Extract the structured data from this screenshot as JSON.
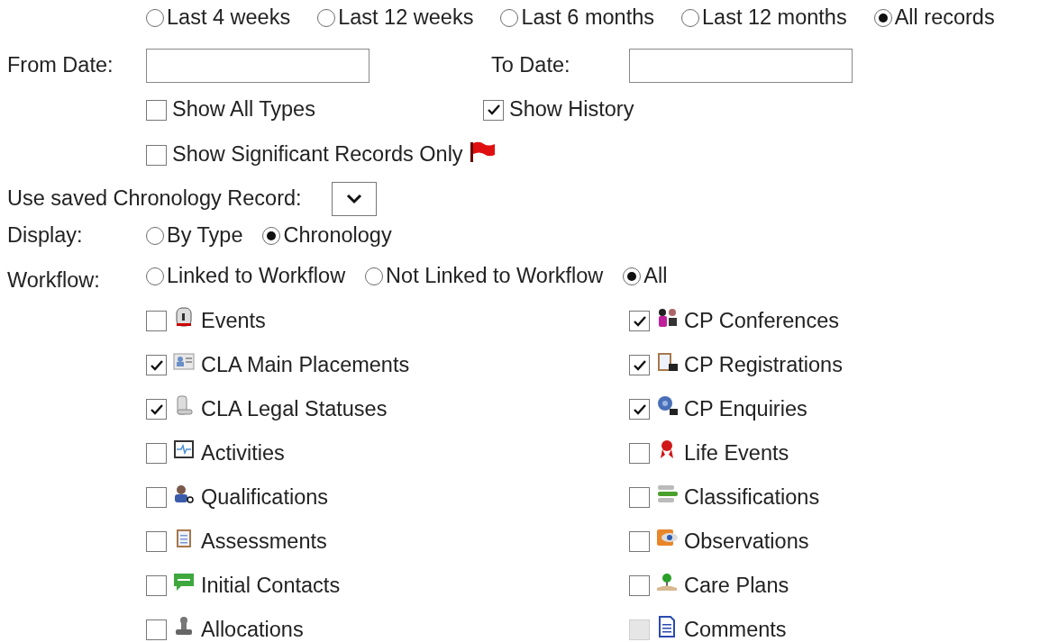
{
  "period_options": [
    {
      "label": "Last 4 weeks",
      "selected": false
    },
    {
      "label": "Last 12 weeks",
      "selected": false
    },
    {
      "label": "Last 6 months",
      "selected": false
    },
    {
      "label": "Last 12 months",
      "selected": false
    },
    {
      "label": "All records",
      "selected": true
    }
  ],
  "from_date": {
    "label": "From Date:"
  },
  "to_date": {
    "label": "To Date:"
  },
  "show_all_types": {
    "label": "Show All Types",
    "checked": false
  },
  "show_history": {
    "label": "Show History",
    "checked": true
  },
  "show_significant": {
    "label": "Show Significant Records Only",
    "checked": false
  },
  "saved_record": {
    "label": "Use saved Chronology Record:"
  },
  "display": {
    "label": "Display:",
    "options": [
      {
        "label": "By Type",
        "selected": false
      },
      {
        "label": "Chronology",
        "selected": true
      }
    ]
  },
  "workflow": {
    "label": "Workflow:",
    "options": [
      {
        "label": "Linked to Workflow",
        "selected": false
      },
      {
        "label": "Not Linked to Workflow",
        "selected": false
      },
      {
        "label": "All",
        "selected": true
      }
    ]
  },
  "record_types": [
    {
      "left": {
        "label": "Events",
        "checked": false,
        "disabled": false
      },
      "right": {
        "label": "CP Conferences",
        "checked": true,
        "disabled": false
      }
    },
    {
      "left": {
        "label": "CLA Main Placements",
        "checked": true,
        "disabled": false
      },
      "right": {
        "label": "CP Registrations",
        "checked": true,
        "disabled": false
      }
    },
    {
      "left": {
        "label": "CLA Legal Statuses",
        "checked": true,
        "disabled": false
      },
      "right": {
        "label": "CP Enquiries",
        "checked": true,
        "disabled": false
      }
    },
    {
      "left": {
        "label": "Activities",
        "checked": false,
        "disabled": false
      },
      "right": {
        "label": "Life Events",
        "checked": false,
        "disabled": false
      }
    },
    {
      "left": {
        "label": "Qualifications",
        "checked": false,
        "disabled": false
      },
      "right": {
        "label": "Classifications",
        "checked": false,
        "disabled": false
      }
    },
    {
      "left": {
        "label": "Assessments",
        "checked": false,
        "disabled": false
      },
      "right": {
        "label": "Observations",
        "checked": false,
        "disabled": false
      }
    },
    {
      "left": {
        "label": "Initial Contacts",
        "checked": false,
        "disabled": false
      },
      "right": {
        "label": "Care Plans",
        "checked": false,
        "disabled": false
      }
    },
    {
      "left": {
        "label": "Allocations",
        "checked": false,
        "disabled": false
      },
      "right": {
        "label": "Comments",
        "checked": false,
        "disabled": true
      }
    }
  ]
}
